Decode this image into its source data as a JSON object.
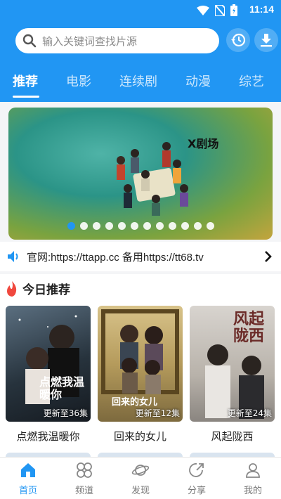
{
  "status": {
    "time": "11:14"
  },
  "search": {
    "placeholder": "输入关键词查找片源"
  },
  "tabs": [
    {
      "label": "推荐",
      "active": true
    },
    {
      "label": "电影"
    },
    {
      "label": "连续剧"
    },
    {
      "label": "动漫"
    },
    {
      "label": "综艺"
    }
  ],
  "banner": {
    "logo": "X剧场",
    "slide_count": 12,
    "active_index": 0
  },
  "notice": {
    "text": "官网:https://ttapp.cc 备用https://tt68.tv"
  },
  "section": {
    "title": "今日推荐"
  },
  "cards": [
    {
      "title": "点燃我温暖你",
      "episodes": "更新至36集",
      "poster_text": "点燃我温暖你"
    },
    {
      "title": "回来的女儿",
      "episodes": "更新至12集",
      "poster_text": "回来的女儿"
    },
    {
      "title": "风起陇西",
      "episodes": "更新至24集",
      "poster_text": "风起陇西"
    }
  ],
  "nav": [
    {
      "label": "首页",
      "icon": "home-icon",
      "active": true
    },
    {
      "label": "频道",
      "icon": "grid-icon"
    },
    {
      "label": "发现",
      "icon": "planet-icon"
    },
    {
      "label": "分享",
      "icon": "share-icon"
    },
    {
      "label": "我的",
      "icon": "user-icon"
    }
  ],
  "colors": {
    "accent": "#2196f3"
  }
}
